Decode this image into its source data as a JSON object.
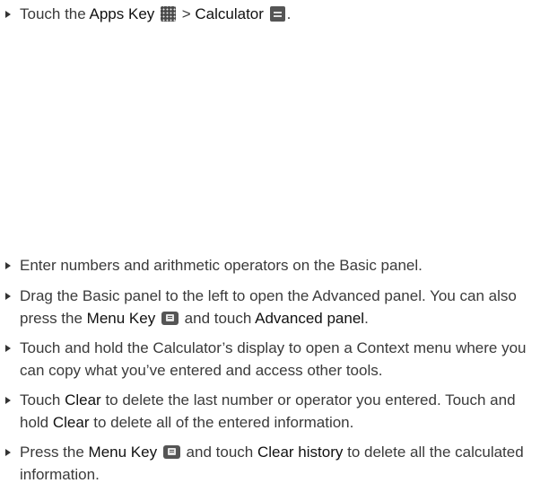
{
  "steps": [
    {
      "t1": "Touch the ",
      "k1": "Apps Key",
      "t2": " > ",
      "k2": "Calculator",
      "t3": "."
    },
    {
      "t1": "Enter numbers and arithmetic operators on the Basic panel."
    },
    {
      "t1": "Drag the Basic panel to the left to open the Advanced panel. You can also press the ",
      "k1": "Menu Key",
      "t2": " and touch ",
      "k2": "Advanced panel",
      "t3": "."
    },
    {
      "t1": "Touch and hold the Calculator’s display to open a Context menu where you can copy what you’ve entered and access other tools."
    },
    {
      "t1": "Touch ",
      "k1": "Clear",
      "t2": " to delete the last number or operator you entered. Touch and hold ",
      "k2": "Clear",
      "t3": " to delete all of the entered information."
    },
    {
      "t1": "Press the ",
      "k1": "Menu Key",
      "t2": " and touch ",
      "k2": "Clear history",
      "t3": " to delete all the calculated information."
    }
  ],
  "icons": {
    "apps": "apps-grid-icon",
    "calculator": "calculator-app-icon",
    "menu": "menu-key-icon"
  }
}
